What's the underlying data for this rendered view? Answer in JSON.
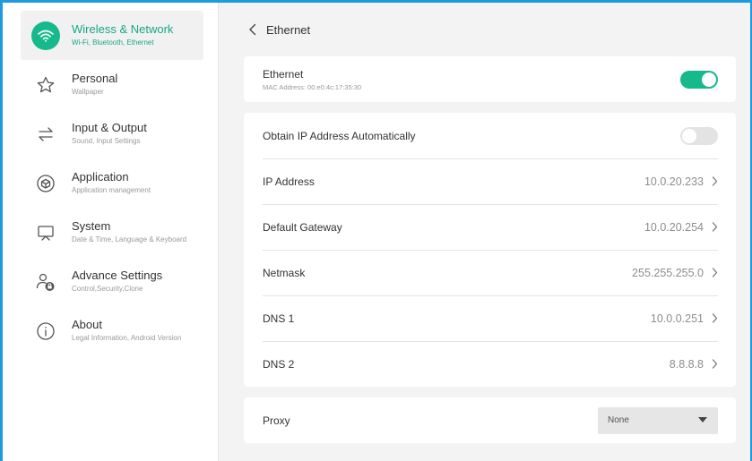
{
  "sidebar": {
    "items": [
      {
        "title": "Wireless & Network",
        "subtitle": "Wi-Fi, Bluetooth, Ethernet",
        "icon": "wifi-icon",
        "active": true
      },
      {
        "title": "Personal",
        "subtitle": "Wallpaper",
        "icon": "star-icon"
      },
      {
        "title": "Input & Output",
        "subtitle": "Sound, Input Settings",
        "icon": "arrows-swap-icon"
      },
      {
        "title": "Application",
        "subtitle": "Application management",
        "icon": "cube-icon"
      },
      {
        "title": "System",
        "subtitle": "Date & Time, Language & Keyboard",
        "icon": "monitor-icon"
      },
      {
        "title": "Advance Settings",
        "subtitle": "Control,Security,Clone",
        "icon": "user-lock-icon"
      },
      {
        "title": "About",
        "subtitle": "Legal Information, Android Version",
        "icon": "info-icon"
      }
    ]
  },
  "header": {
    "title": "Ethernet"
  },
  "ethernet": {
    "label": "Ethernet",
    "mac": "MAC Address: 00:e0:4c:17:35:30",
    "enabled": true
  },
  "network": {
    "obtain_auto": {
      "label": "Obtain IP Address Automatically",
      "enabled": false
    },
    "rows": [
      {
        "label": "IP Address",
        "value": "10.0.20.233"
      },
      {
        "label": "Default Gateway",
        "value": "10.0.20.254"
      },
      {
        "label": "Netmask",
        "value": "255.255.255.0"
      },
      {
        "label": "DNS 1",
        "value": "10.0.0.251"
      },
      {
        "label": "DNS 2",
        "value": "8.8.8.8"
      }
    ]
  },
  "proxy": {
    "label": "Proxy",
    "selected": "None"
  },
  "colors": {
    "accent": "#16b98b",
    "border": "#1e9be0"
  }
}
